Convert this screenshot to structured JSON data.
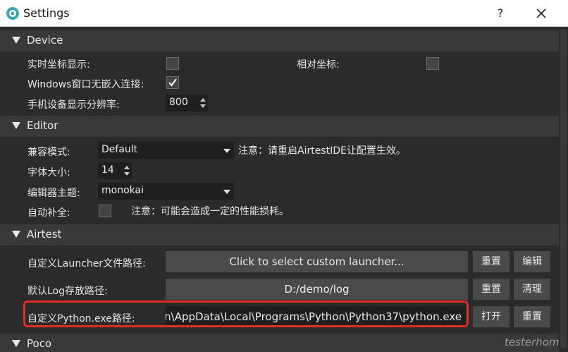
{
  "window": {
    "title": "Settings",
    "help": "?",
    "close": "✕"
  },
  "device": {
    "header": "Device",
    "realtime_coord_label": "实时坐标显示:",
    "relative_coord_label": "相对坐标:",
    "windows_embed_label": "Windows窗口无嵌入连接:",
    "resolution_label": "手机设备显示分辨率:",
    "resolution_value": "800",
    "realtime_coord_checked": false,
    "relative_coord_checked": false,
    "windows_embed_checked": true
  },
  "editor": {
    "header": "Editor",
    "compat_label": "兼容模式:",
    "compat_value": "Default",
    "compat_note": "注意：请重启AirtestIDE让配置生效。",
    "font_size_label": "字体大小:",
    "font_size_value": "14",
    "theme_label": "编辑器主题:",
    "theme_value": "monokai",
    "autocomplete_label": "自动补全:",
    "autocomplete_checked": false,
    "autocomplete_note": "注意：可能会造成一定的性能损耗。"
  },
  "airtest": {
    "header": "Airtest",
    "launcher_label": "自定义Launcher文件路径:",
    "launcher_button": "Click to select custom launcher...",
    "launcher_reset": "重置",
    "launcher_edit": "编辑",
    "log_label": "默认Log存放路径:",
    "log_path": "D:/demo/log",
    "log_reset": "重置",
    "log_clear": "清理",
    "python_label": "自定义Python.exe路径:",
    "python_path": "n\\AppData\\Local\\Programs\\Python\\Python37\\python.exe",
    "python_open": "打开",
    "python_reset": "重置"
  },
  "poco": {
    "header": "Poco"
  },
  "watermark": "testerhome.com",
  "colors": {
    "highlight": "#e02b2b",
    "background": "#2b2b2b",
    "section": "#393939"
  }
}
